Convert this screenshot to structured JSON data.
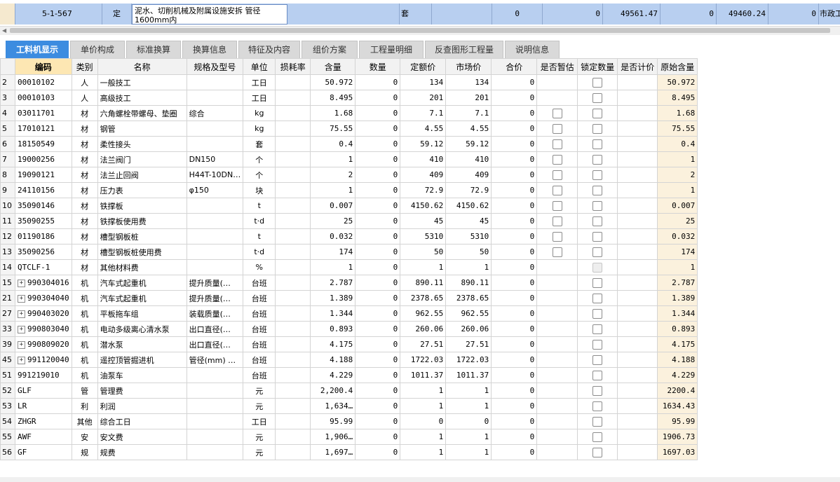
{
  "top_row": {
    "code": "5-1-567",
    "type": "定",
    "name": "泥水、切削机械及附属设施安拆 管径1600mm内",
    "unit": "套",
    "v1": "0",
    "v2": "0",
    "v3": "49561.47",
    "v4": "0",
    "v5": "49460.24",
    "v6": "0",
    "category": "市政工"
  },
  "tabs": [
    {
      "label": "工料机显示",
      "active": true
    },
    {
      "label": "单价构成",
      "active": false
    },
    {
      "label": "标准换算",
      "active": false
    },
    {
      "label": "换算信息",
      "active": false
    },
    {
      "label": "特征及内容",
      "active": false
    },
    {
      "label": "组价方案",
      "active": false
    },
    {
      "label": "工程量明细",
      "active": false
    },
    {
      "label": "反查图形工程量",
      "active": false
    },
    {
      "label": "说明信息",
      "active": false
    }
  ],
  "columns": [
    "编码",
    "类别",
    "名称",
    "规格及型号",
    "单位",
    "损耗率",
    "含量",
    "数量",
    "定额价",
    "市场价",
    "合价",
    "是否暂估",
    "锁定数量",
    "是否计价",
    "原始含量"
  ],
  "rows": [
    {
      "rn": "2",
      "code": "00010102",
      "expand": false,
      "type": "人",
      "name": "一般技工",
      "spec": "",
      "unit": "工日",
      "qty": "50.972",
      "amount": "0",
      "quota": "134",
      "market": "134",
      "total": "0",
      "est": "none",
      "lock": "box",
      "orig": "50.972"
    },
    {
      "rn": "3",
      "code": "00010103",
      "expand": false,
      "type": "人",
      "name": "高级技工",
      "spec": "",
      "unit": "工日",
      "qty": "8.495",
      "amount": "0",
      "quota": "201",
      "market": "201",
      "total": "0",
      "est": "none",
      "lock": "box",
      "orig": "8.495"
    },
    {
      "rn": "4",
      "code": "03011701",
      "expand": false,
      "type": "材",
      "name": "六角螺栓带螺母、垫圈",
      "spec": "综合",
      "unit": "kg",
      "qty": "1.68",
      "amount": "0",
      "quota": "7.1",
      "market": "7.1",
      "total": "0",
      "est": "box",
      "lock": "box",
      "orig": "1.68"
    },
    {
      "rn": "5",
      "code": "17010121",
      "expand": false,
      "type": "材",
      "name": "钢管",
      "spec": "",
      "unit": "kg",
      "qty": "75.55",
      "amount": "0",
      "quota": "4.55",
      "market": "4.55",
      "total": "0",
      "est": "box",
      "lock": "box",
      "orig": "75.55"
    },
    {
      "rn": "6",
      "code": "18150549",
      "expand": false,
      "type": "材",
      "name": "柔性接头",
      "spec": "",
      "unit": "套",
      "qty": "0.4",
      "amount": "0",
      "quota": "59.12",
      "market": "59.12",
      "total": "0",
      "est": "box",
      "lock": "box",
      "orig": "0.4"
    },
    {
      "rn": "7",
      "code": "19000256",
      "expand": false,
      "type": "材",
      "name": "法兰阀门",
      "spec": "DN150",
      "unit": "个",
      "qty": "1",
      "amount": "0",
      "quota": "410",
      "market": "410",
      "total": "0",
      "est": "box",
      "lock": "box",
      "orig": "1"
    },
    {
      "rn": "8",
      "code": "19090121",
      "expand": false,
      "type": "材",
      "name": "法兰止回阀",
      "spec": "H44T-10DN…",
      "unit": "个",
      "qty": "2",
      "amount": "0",
      "quota": "409",
      "market": "409",
      "total": "0",
      "est": "box",
      "lock": "box",
      "orig": "2"
    },
    {
      "rn": "9",
      "code": "24110156",
      "expand": false,
      "type": "材",
      "name": "压力表",
      "spec": "φ150",
      "unit": "块",
      "qty": "1",
      "amount": "0",
      "quota": "72.9",
      "market": "72.9",
      "total": "0",
      "est": "box",
      "lock": "box",
      "orig": "1"
    },
    {
      "rn": "10",
      "code": "35090146",
      "expand": false,
      "type": "材",
      "name": "铁撑板",
      "spec": "",
      "unit": "t",
      "qty": "0.007",
      "amount": "0",
      "quota": "4150.62",
      "market": "4150.62",
      "total": "0",
      "est": "box",
      "lock": "box",
      "orig": "0.007"
    },
    {
      "rn": "11",
      "code": "35090255",
      "expand": false,
      "type": "材",
      "name": "铁撑板使用费",
      "spec": "",
      "unit": "t·d",
      "qty": "25",
      "amount": "0",
      "quota": "45",
      "market": "45",
      "total": "0",
      "est": "box",
      "lock": "box",
      "orig": "25"
    },
    {
      "rn": "12",
      "code": "01190186",
      "expand": false,
      "type": "材",
      "name": "槽型钢板桩",
      "spec": "",
      "unit": "t",
      "qty": "0.032",
      "amount": "0",
      "quota": "5310",
      "market": "5310",
      "total": "0",
      "est": "box",
      "lock": "box",
      "orig": "0.032"
    },
    {
      "rn": "13",
      "code": "35090256",
      "expand": false,
      "type": "材",
      "name": "槽型钢板桩使用费",
      "spec": "",
      "unit": "t·d",
      "qty": "174",
      "amount": "0",
      "quota": "50",
      "market": "50",
      "total": "0",
      "est": "box",
      "lock": "box",
      "orig": "174"
    },
    {
      "rn": "14",
      "code": "QTCLF-1",
      "expand": false,
      "type": "材",
      "name": "其他材料费",
      "spec": "",
      "unit": "%",
      "qty": "1",
      "amount": "0",
      "quota": "1",
      "market": "1",
      "total": "0",
      "est": "none",
      "lock": "dis",
      "orig": "1"
    },
    {
      "rn": "15",
      "code": "990304016",
      "expand": true,
      "type": "机",
      "name": "汽车式起重机",
      "spec": "提升质量(…",
      "unit": "台班",
      "qty": "2.787",
      "amount": "0",
      "quota": "890.11",
      "market": "890.11",
      "total": "0",
      "est": "none",
      "lock": "box",
      "orig": "2.787"
    },
    {
      "rn": "21",
      "code": "990304040",
      "expand": true,
      "type": "机",
      "name": "汽车式起重机",
      "spec": "提升质量(…",
      "unit": "台班",
      "qty": "1.389",
      "amount": "0",
      "quota": "2378.65",
      "market": "2378.65",
      "total": "0",
      "est": "none",
      "lock": "box",
      "orig": "1.389"
    },
    {
      "rn": "27",
      "code": "990403020",
      "expand": true,
      "type": "机",
      "name": "平板拖车组",
      "spec": "装载质量(…",
      "unit": "台班",
      "qty": "1.344",
      "amount": "0",
      "quota": "962.55",
      "market": "962.55",
      "total": "0",
      "est": "none",
      "lock": "box",
      "orig": "1.344"
    },
    {
      "rn": "33",
      "code": "990803040",
      "expand": true,
      "type": "机",
      "name": "电动多级离心清水泵",
      "spec": "出口直径(…",
      "unit": "台班",
      "qty": "0.893",
      "amount": "0",
      "quota": "260.06",
      "market": "260.06",
      "total": "0",
      "est": "none",
      "lock": "box",
      "orig": "0.893"
    },
    {
      "rn": "39",
      "code": "990809020",
      "expand": true,
      "type": "机",
      "name": "潜水泵",
      "spec": "出口直径(…",
      "unit": "台班",
      "qty": "4.175",
      "amount": "0",
      "quota": "27.51",
      "market": "27.51",
      "total": "0",
      "est": "none",
      "lock": "box",
      "orig": "4.175"
    },
    {
      "rn": "45",
      "code": "991120040",
      "expand": true,
      "type": "机",
      "name": "遥控顶管掘进机",
      "spec": "管径(mm) …",
      "unit": "台班",
      "qty": "4.188",
      "amount": "0",
      "quota": "1722.03",
      "market": "1722.03",
      "total": "0",
      "est": "none",
      "lock": "box",
      "orig": "4.188"
    },
    {
      "rn": "51",
      "code": "991219010",
      "expand": false,
      "type": "机",
      "name": "油泵车",
      "spec": "",
      "unit": "台班",
      "qty": "4.229",
      "amount": "0",
      "quota": "1011.37",
      "market": "1011.37",
      "total": "0",
      "est": "none",
      "lock": "box",
      "orig": "4.229"
    },
    {
      "rn": "52",
      "code": "GLF",
      "expand": false,
      "type": "管",
      "name": "管理费",
      "spec": "",
      "unit": "元",
      "qty": "2,200.4",
      "amount": "0",
      "quota": "1",
      "market": "1",
      "total": "0",
      "est": "none",
      "lock": "box",
      "orig": "2200.4"
    },
    {
      "rn": "53",
      "code": "LR",
      "expand": false,
      "type": "利",
      "name": "利润",
      "spec": "",
      "unit": "元",
      "qty": "1,634…",
      "amount": "0",
      "quota": "1",
      "market": "1",
      "total": "0",
      "est": "none",
      "lock": "box",
      "orig": "1634.43"
    },
    {
      "rn": "54",
      "code": "ZHGR",
      "expand": false,
      "type": "其他",
      "name": "综合工日",
      "spec": "",
      "unit": "工日",
      "qty": "95.99",
      "amount": "0",
      "quota": "0",
      "market": "0",
      "total": "0",
      "est": "none",
      "lock": "box",
      "orig": "95.99"
    },
    {
      "rn": "55",
      "code": "AWF",
      "expand": false,
      "type": "安",
      "name": "安文费",
      "spec": "",
      "unit": "元",
      "qty": "1,906…",
      "amount": "0",
      "quota": "1",
      "market": "1",
      "total": "0",
      "est": "none",
      "lock": "box",
      "orig": "1906.73"
    },
    {
      "rn": "56",
      "code": "GF",
      "expand": false,
      "type": "规",
      "name": "规费",
      "spec": "",
      "unit": "元",
      "qty": "1,697…",
      "amount": "0",
      "quota": "1",
      "market": "1",
      "total": "0",
      "est": "none",
      "lock": "box",
      "orig": "1697.03"
    }
  ]
}
